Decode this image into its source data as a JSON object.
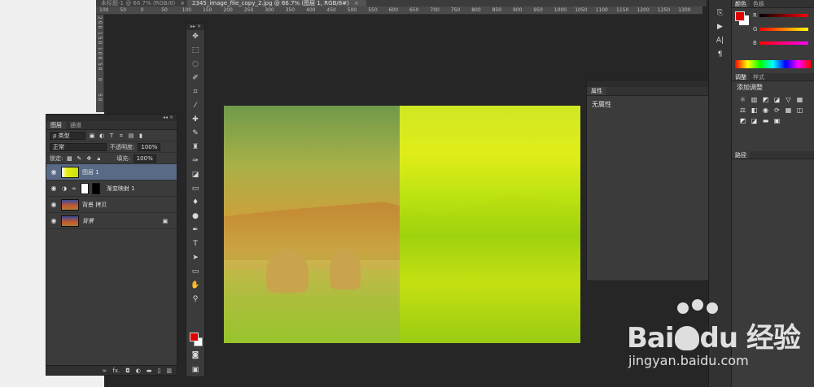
{
  "document_tabs": [
    {
      "label": "未标题-1 @ 66.7% (RGB/8)",
      "close": "×"
    },
    {
      "label": "2345_image_file_copy_2.jpg @ 66.7% (图层 1, RGB/8#)",
      "close": "×"
    }
  ],
  "ruler_top": [
    "100",
    "50",
    "0",
    "50",
    "100",
    "150",
    "200",
    "250",
    "300",
    "350",
    "400",
    "450",
    "500",
    "550",
    "600",
    "650",
    "700",
    "750",
    "800",
    "850",
    "900",
    "950",
    "1000",
    "1050",
    "1100",
    "1150",
    "1200",
    "1250",
    "1300"
  ],
  "ruler_left": [
    "2 0 0",
    "1 5 0",
    "1 0 0",
    "5 0",
    "0",
    "5 0"
  ],
  "layers_panel": {
    "tabs": [
      "图层",
      "通道"
    ],
    "filter_kind": "ρ 类型",
    "blend_mode": "正常",
    "opacity_label": "不透明度:",
    "opacity_value": "100%",
    "lock_label": "锁定:",
    "fill_label": "填充:",
    "fill_value": "100%",
    "layers": [
      {
        "name": "图层 1",
        "selected": true
      },
      {
        "name": "渐变映射 1",
        "selected": false
      },
      {
        "name": "背景 拷贝",
        "selected": false
      },
      {
        "name": "背景",
        "selected": false
      }
    ],
    "footer_icons": [
      "link-icon",
      "fx-icon",
      "mask-icon",
      "adjustment-icon",
      "folder-icon",
      "new-layer-icon",
      "trash-icon"
    ],
    "footer_fx": "fx."
  },
  "tools": [
    "move-icon",
    "marquee-icon",
    "lasso-icon",
    "quick-select-icon",
    "crop-icon",
    "eyedropper-icon",
    "healing-icon",
    "brush-icon",
    "stamp-icon",
    "history-brush-icon",
    "eraser-icon",
    "gradient-icon",
    "blur-icon",
    "dodge-icon",
    "pen-icon",
    "type-icon",
    "path-select-icon",
    "rectangle-icon",
    "hand-icon",
    "zoom-icon"
  ],
  "tools_type_glyph": "T",
  "properties_panel": {
    "title": "属性",
    "content": "无属性"
  },
  "color_panel": {
    "tabs": [
      "颜色",
      "色板"
    ],
    "channels": [
      "R",
      "G",
      "B"
    ],
    "foreground": "#e00000",
    "background": "#ffffff"
  },
  "adjustments_panel": {
    "tabs": [
      "调整",
      "样式"
    ],
    "title": "添加调整"
  },
  "paths_panel": {
    "tab": "路径"
  },
  "right_strip_glyphs": {
    "char": "A|",
    "para": "¶"
  },
  "watermark": {
    "brand_left": "Bai",
    "brand_right": "du 经验",
    "url": "jingyan.baidu.com"
  },
  "colors": {
    "foreground_swatch": "#e00000",
    "background_swatch": "#ffffff",
    "selected_layer": "#586a86"
  }
}
